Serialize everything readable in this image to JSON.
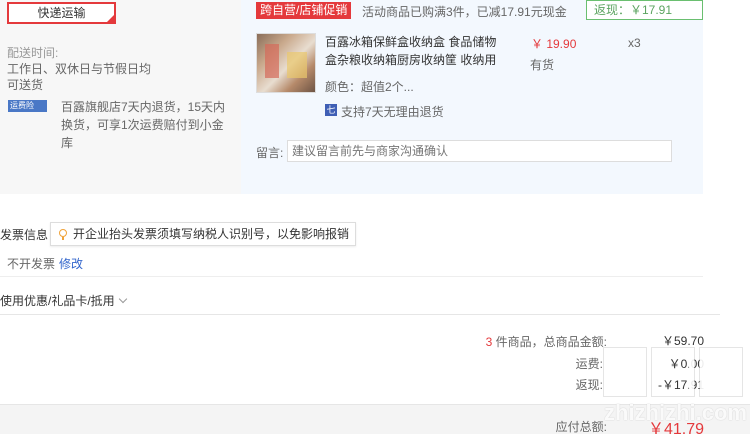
{
  "shipping": {
    "method_label": "快递运输",
    "time_title": "配送时间:",
    "time_line1": "工作日、双休日与节假日均",
    "time_line2": "可送货",
    "insurance_icon": "运费险",
    "insurance_line1": "百露旗舰店7天内退货，15天内",
    "insurance_line2": "换货，可享1次运费赔付到小金",
    "insurance_line3": "库"
  },
  "promo": {
    "tag": "跨自营/店铺促销",
    "text": "活动商品已购满3件，已减17.91元现金",
    "rebate": "返现：￥17.91"
  },
  "product": {
    "name_line1": "百露冰箱保鲜盒收纳盒 食品储物",
    "name_line2": "盒杂粮收纳箱厨房收纳筐 收纳用",
    "price": "￥ 19.90",
    "quantity": "x3",
    "stock": "有货",
    "color": "颜色：超值2个...",
    "return_icon": "七",
    "return_policy": "支持7天无理由退货"
  },
  "message": {
    "label": "留言:",
    "placeholder": "建议留言前先与商家沟通确认"
  },
  "invoice": {
    "title": "发票信息",
    "tip": "开企业抬头发票须填写纳税人识别号，以免影响报销",
    "value": "不开发票",
    "edit_link": "修改"
  },
  "discount": {
    "label": "使用优惠/礼品卡/抵用"
  },
  "summary": {
    "item_count": "3",
    "items_label": "件商品，总商品金额:",
    "items_amount": "￥59.70",
    "shipping_label": "运费:",
    "shipping_amount": "￥0.00",
    "rebate_label": "返现:",
    "rebate_amount": "-￥17.91",
    "total_label": "应付总额:",
    "total_amount": "￥41.79"
  },
  "watermark": {
    "text": "zhizhizhi.com"
  },
  "colors": {
    "accent_red": "#e4393c",
    "link_blue": "#3366cc",
    "rebate_green": "#5aa35f",
    "panel_blue": "#f3f8fe"
  }
}
